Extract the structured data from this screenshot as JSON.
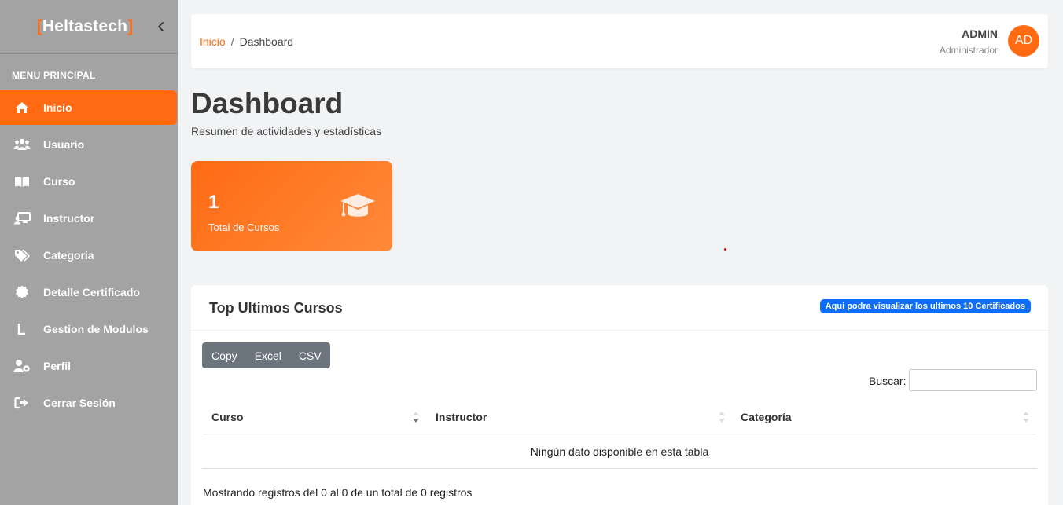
{
  "brand": {
    "open": "[",
    "name": "Heltastech",
    "close": "]"
  },
  "sidebar": {
    "header": "MENU PRINCIPAL",
    "items": [
      {
        "label": "Inicio",
        "icon": "home-icon",
        "active": true
      },
      {
        "label": "Usuario",
        "icon": "users-icon"
      },
      {
        "label": "Curso",
        "icon": "book-icon"
      },
      {
        "label": "Instructor",
        "icon": "chalkboard-teacher-icon"
      },
      {
        "label": "Categoria",
        "icon": "tags-icon"
      },
      {
        "label": "Detalle Certificado",
        "icon": "certificate-icon"
      },
      {
        "label": "Gestion de Modulos",
        "icon": "l-letter-icon"
      },
      {
        "label": "Perfil",
        "icon": "user-cog-icon"
      },
      {
        "label": "Cerrar Sesión",
        "icon": "sign-out-icon"
      }
    ]
  },
  "topbar": {
    "breadcrumb": {
      "home": "Inicio",
      "separator": "/",
      "current": "Dashboard"
    },
    "user": {
      "name": "ADMIN",
      "role": "Administrador",
      "initials": "AD"
    }
  },
  "page": {
    "title": "Dashboard",
    "subtitle": "Resumen de actividades y estadísticas"
  },
  "stats": [
    {
      "value": "1",
      "label": "Total de Cursos",
      "icon": "graduation-cap-icon"
    }
  ],
  "table_card": {
    "title": "Top Ultimos Cursos",
    "badge": "Aqui podra visualizar los ultimos 10 Certificados",
    "buttons": [
      "Copy",
      "Excel",
      "CSV"
    ],
    "search_label": "Buscar:",
    "search_value": "",
    "columns": [
      "Curso",
      "Instructor",
      "Categoría"
    ],
    "empty_message": "Ningún dato disponible en esta tabla",
    "info": "Mostrando registros del 0 al 0 de un total de 0 registros"
  },
  "colors": {
    "accent": "#ff6a13",
    "sidebar_bg": "#a3a3a3",
    "badge_blue": "#0d6efd",
    "button_gray": "#6c757d"
  }
}
